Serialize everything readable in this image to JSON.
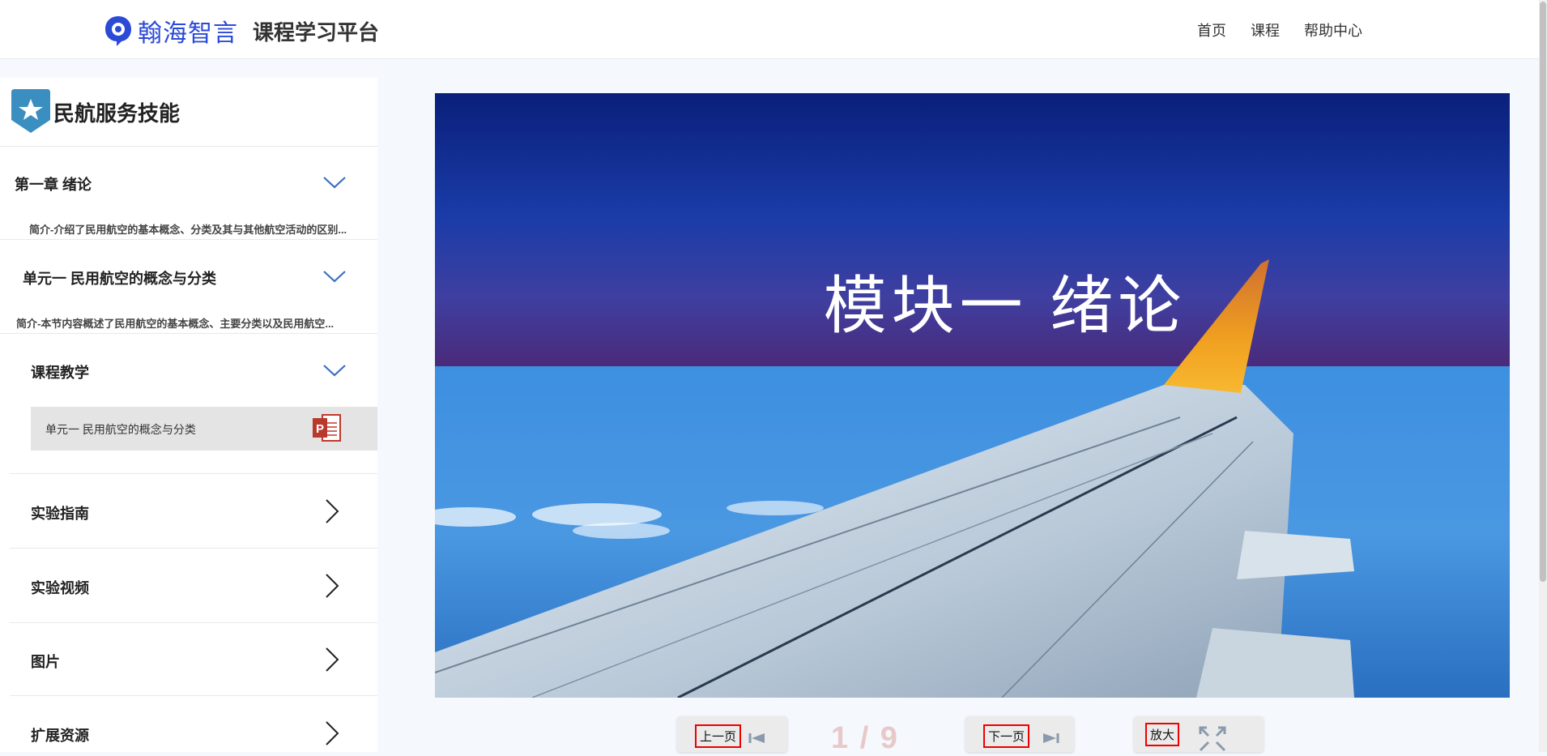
{
  "header": {
    "brand": "翰海智言",
    "subtitle": "课程学习平台",
    "nav": [
      "首页",
      "课程",
      "帮助中心"
    ]
  },
  "sidebar": {
    "course_title": "民航服务技能",
    "chapter": {
      "title": "第一章 绪论",
      "desc": "简介-介绍了民用航空的基本概念、分类及其与其他航空活动的区别..."
    },
    "unit": {
      "title": "单元一 民用航空的概念与分类",
      "desc": "简介-本节内容概述了民用航空的基本概念、主要分类以及民用航空..."
    },
    "teaching": {
      "title": "课程教学",
      "file_name": "单元一 民用航空的概念与分类",
      "file_icon": "ppt-icon"
    },
    "sections": [
      "实验指南",
      "实验视频",
      "图片",
      "扩展资源"
    ]
  },
  "viewer": {
    "slide_title": "模块一  绪论",
    "prev_label": "上一页",
    "next_label": "下一页",
    "zoom_label": "放大",
    "page_info": "1 / 9"
  },
  "colors": {
    "accent": "#2b4ad6",
    "chevron": "#3a6fc0",
    "sky_top": "#0a1f7a",
    "title_band_bottom": "#3a2a7a"
  }
}
